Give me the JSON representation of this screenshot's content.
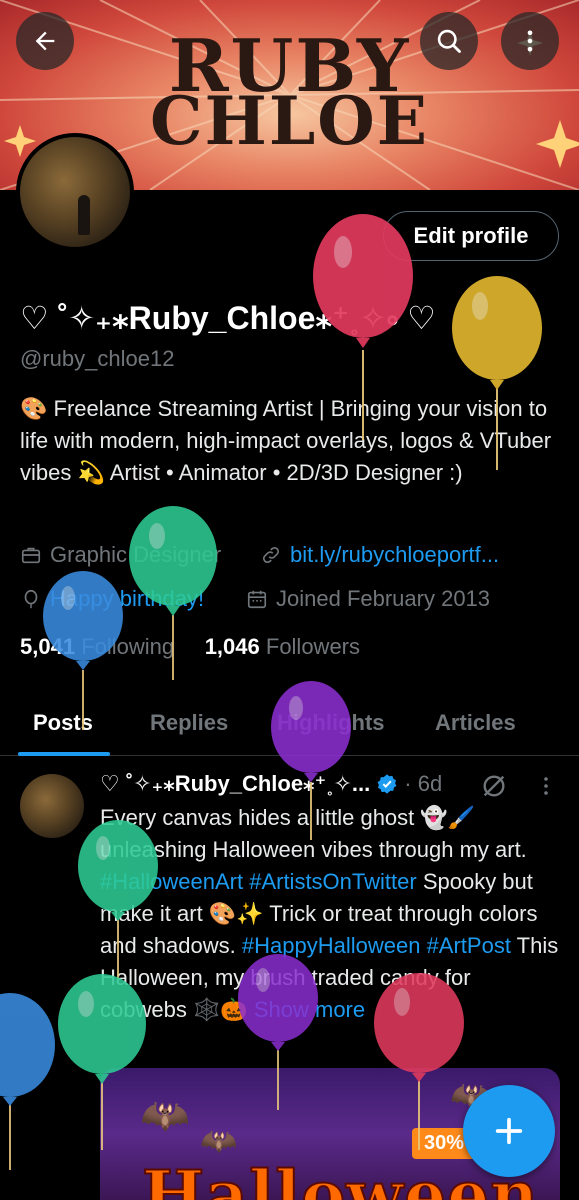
{
  "banner": {
    "title_line1": "RUBY",
    "title_line2": "CHLOE"
  },
  "top_actions": {
    "back_icon": "arrow-left-icon",
    "search_icon": "search-icon",
    "more_icon": "more-vertical-icon"
  },
  "profile": {
    "edit_label": "Edit profile",
    "display_name": "♡ ˚✧₊⁎Ruby_Chloe⁎⁺˳✧༚ ♡",
    "handle": "@ruby_chloe12",
    "bio": "🎨 Freelance Streaming Artist | Bringing your vision to life with modern, high-impact overlays, logos & VTuber vibes 💫 Artist • Animator • 2D/3D Designer :)",
    "category": "Graphic Designer",
    "link": "bit.ly/rubychloeportf...",
    "birthday": "Happy birthday!",
    "joined": "Joined February 2013",
    "following_count": "5,041",
    "following_label": "Following",
    "followers_count": "1,046",
    "followers_label": "Followers"
  },
  "tabs": [
    {
      "label": "Posts"
    },
    {
      "label": "Replies"
    },
    {
      "label": "Highlights"
    },
    {
      "label": "Articles"
    }
  ],
  "post": {
    "author": "♡ ˚✧₊⁎Ruby_Chloe⁎⁺˳✧...",
    "time": "· 6d",
    "text_1": "Every canvas hides a little ghost 👻🖌️ unleashing Halloween vibes through my art. ",
    "hashtag_1": "#HalloweenArt",
    "hashtag_2": "#ArtistsOnTwitter",
    "text_2": "Spooky but make it art 🎨✨ Trick or treat through colors and shadows. ",
    "hashtag_3": "#HappyHalloween",
    "hashtag_4": "#ArtPost",
    "text_3": " This Halloween, my brush traded candy for cobwebs 🕸️🎃 ",
    "show_more": "Show more",
    "image_badge": "30%",
    "image_title": "Halloween"
  },
  "colors": {
    "accent": "#1d9bf0",
    "muted": "#71767b",
    "background": "#000000"
  }
}
